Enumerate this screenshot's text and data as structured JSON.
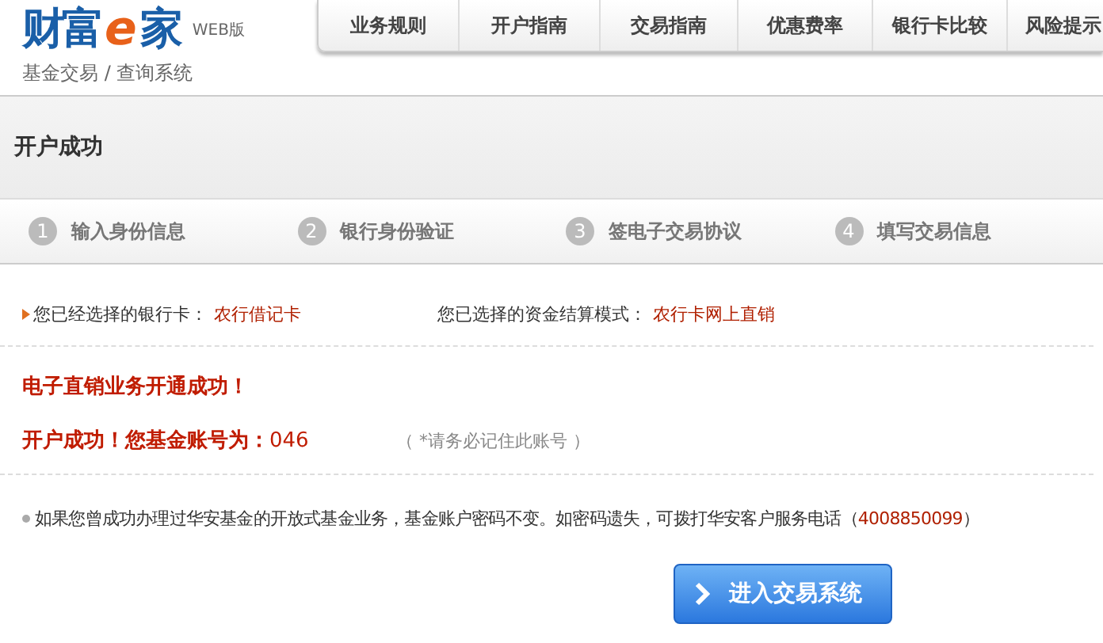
{
  "logo": {
    "parts": [
      "财富",
      "e",
      "家"
    ],
    "edition": "WEB版",
    "subtitle": "基金交易 / 查询系统"
  },
  "nav": [
    {
      "label": "业务规则"
    },
    {
      "label": "开户指南"
    },
    {
      "label": "交易指南"
    },
    {
      "label": "优惠费率"
    },
    {
      "label": "银行卡比较"
    },
    {
      "label": "风险提示"
    }
  ],
  "page_title": "开户成功",
  "steps": [
    {
      "number": "1",
      "label": "输入身份信息"
    },
    {
      "number": "2",
      "label": "银行身份验证"
    },
    {
      "number": "3",
      "label": "签电子交易协议"
    },
    {
      "number": "4",
      "label": "填写交易信息"
    }
  ],
  "selection": [
    {
      "label": "您已经选择的银行卡：",
      "value": "农行借记卡"
    },
    {
      "label": "您已选择的资金结算模式：",
      "value": "农行卡网上直销"
    }
  ],
  "success_message": "电子直销业务开通成功！",
  "account": {
    "label": "开户成功！您基金账号为：",
    "value": "046",
    "hint": "（ *请务必记住此账号 ）"
  },
  "note": {
    "text": "如果您曾成功办理过华安基金的开放式基金业务，基金账户密码不变。如密码遗失，可拨打华安客户服务电话（",
    "phone": "4008850099",
    "close": "）"
  },
  "button": {
    "label": "进入交易系统"
  }
}
